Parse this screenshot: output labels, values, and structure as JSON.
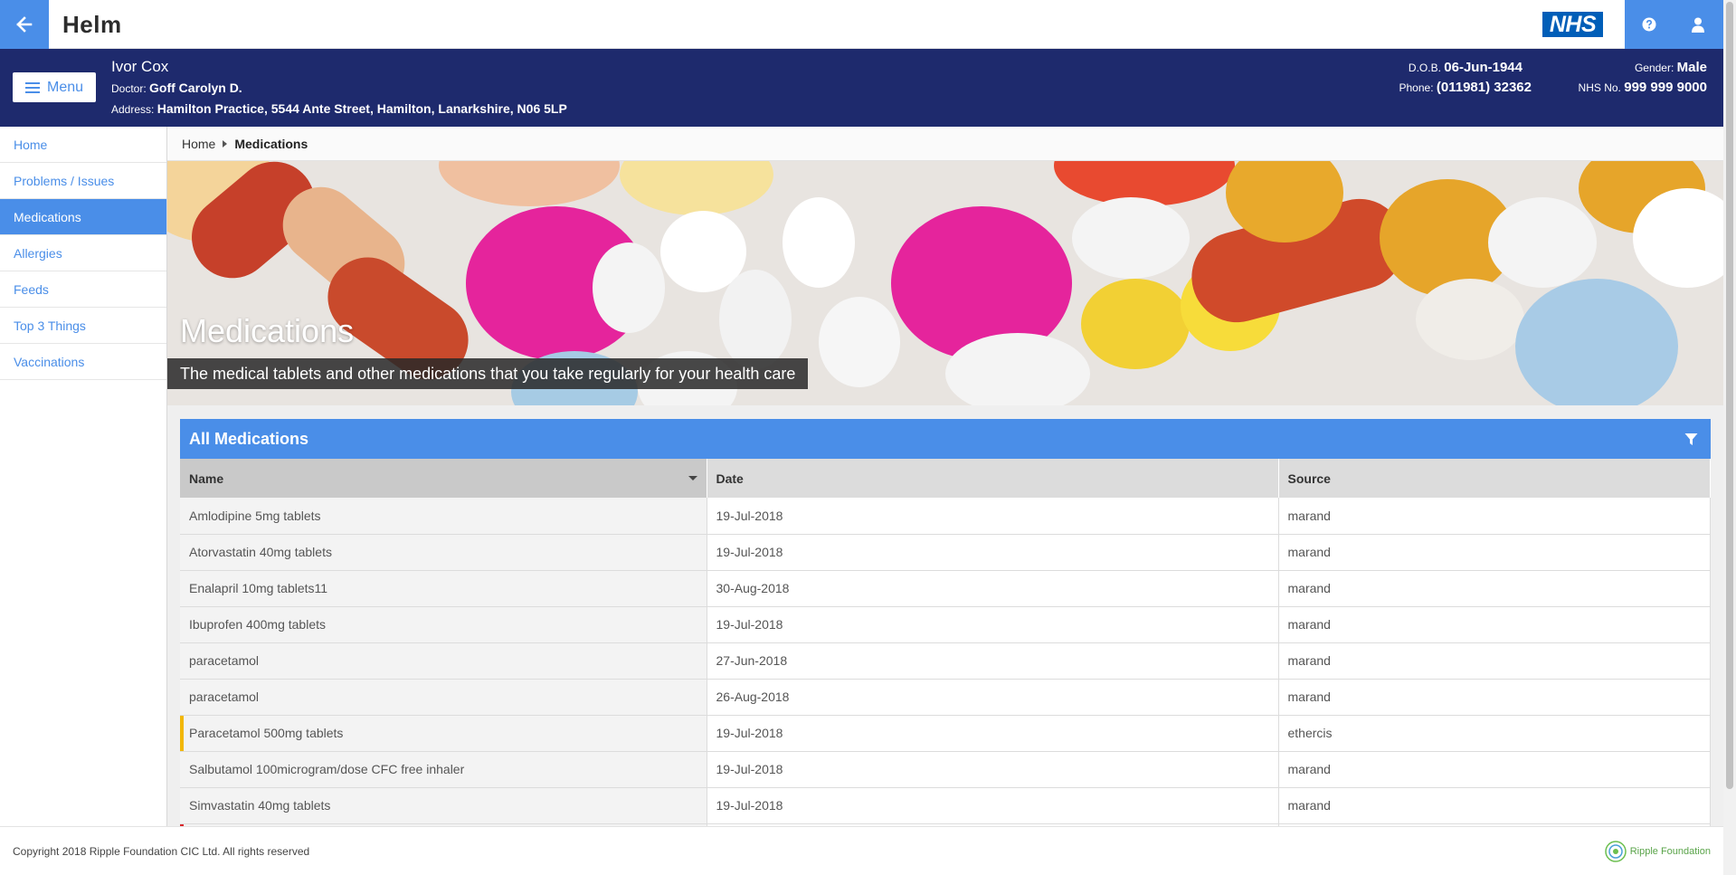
{
  "app": {
    "name": "Helm",
    "nhs_logo_text": "NHS"
  },
  "topbar": {
    "back_icon": "arrow-left-icon",
    "help_icon": "question-circle-icon",
    "user_icon": "user-icon",
    "accent_color": "#4a8ee8"
  },
  "patient": {
    "name": "Ivor Cox",
    "doctor_label": "Doctor:",
    "doctor": "Goff Carolyn D.",
    "address_label": "Address:",
    "address": "Hamilton Practice, 5544 Ante Street, Hamilton, Lanarkshire, N06 5LP",
    "dob_label": "D.O.B.",
    "dob": "06-Jun-1944",
    "phone_label": "Phone:",
    "phone": "(011981) 32362",
    "gender_label": "Gender:",
    "gender": "Male",
    "nhs_label": "NHS No.",
    "nhs_no": "999 999 9000",
    "banner_color": "#1e2a6d"
  },
  "menu": {
    "label": "Menu"
  },
  "sidebar": {
    "items": [
      {
        "label": "Home",
        "active": false
      },
      {
        "label": "Problems / Issues",
        "active": false
      },
      {
        "label": "Medications",
        "active": true
      },
      {
        "label": "Allergies",
        "active": false
      },
      {
        "label": "Feeds",
        "active": false
      },
      {
        "label": "Top 3 Things",
        "active": false
      },
      {
        "label": "Vaccinations",
        "active": false
      }
    ]
  },
  "breadcrumb": {
    "home": "Home",
    "current": "Medications"
  },
  "hero": {
    "title": "Medications",
    "subtitle": "The medical tablets and other medications that you take regularly for your health care"
  },
  "panel": {
    "title": "All Medications",
    "filter_icon": "filter-icon",
    "columns": [
      "Name",
      "Date",
      "Source"
    ],
    "sorted_column": "Name",
    "rows": [
      {
        "name": "Amlodipine 5mg tablets",
        "date": "19-Jul-2018",
        "source": "marand",
        "flag": ""
      },
      {
        "name": "Atorvastatin 40mg tablets",
        "date": "19-Jul-2018",
        "source": "marand",
        "flag": ""
      },
      {
        "name": "Enalapril 10mg tablets11",
        "date": "30-Aug-2018",
        "source": "marand",
        "flag": ""
      },
      {
        "name": "Ibuprofen 400mg tablets",
        "date": "19-Jul-2018",
        "source": "marand",
        "flag": ""
      },
      {
        "name": "paracetamol",
        "date": "27-Jun-2018",
        "source": "marand",
        "flag": ""
      },
      {
        "name": "paracetamol",
        "date": "26-Aug-2018",
        "source": "marand",
        "flag": ""
      },
      {
        "name": "Paracetamol 500mg tablets",
        "date": "19-Jul-2018",
        "source": "ethercis",
        "flag": "amber"
      },
      {
        "name": "Salbutamol 100microgram/dose CFC free inhaler",
        "date": "19-Jul-2018",
        "source": "marand",
        "flag": ""
      },
      {
        "name": "Simvastatin 40mg tablets",
        "date": "19-Jul-2018",
        "source": "marand",
        "flag": ""
      },
      {
        "name": "",
        "date": "",
        "source": "",
        "flag": "red"
      }
    ]
  },
  "footer": {
    "copyright": "Copyright 2018 Ripple Foundation CIC Ltd. All rights reserved",
    "brand": "Ripple Foundation",
    "brand_icon": "ripple-logo-icon"
  }
}
